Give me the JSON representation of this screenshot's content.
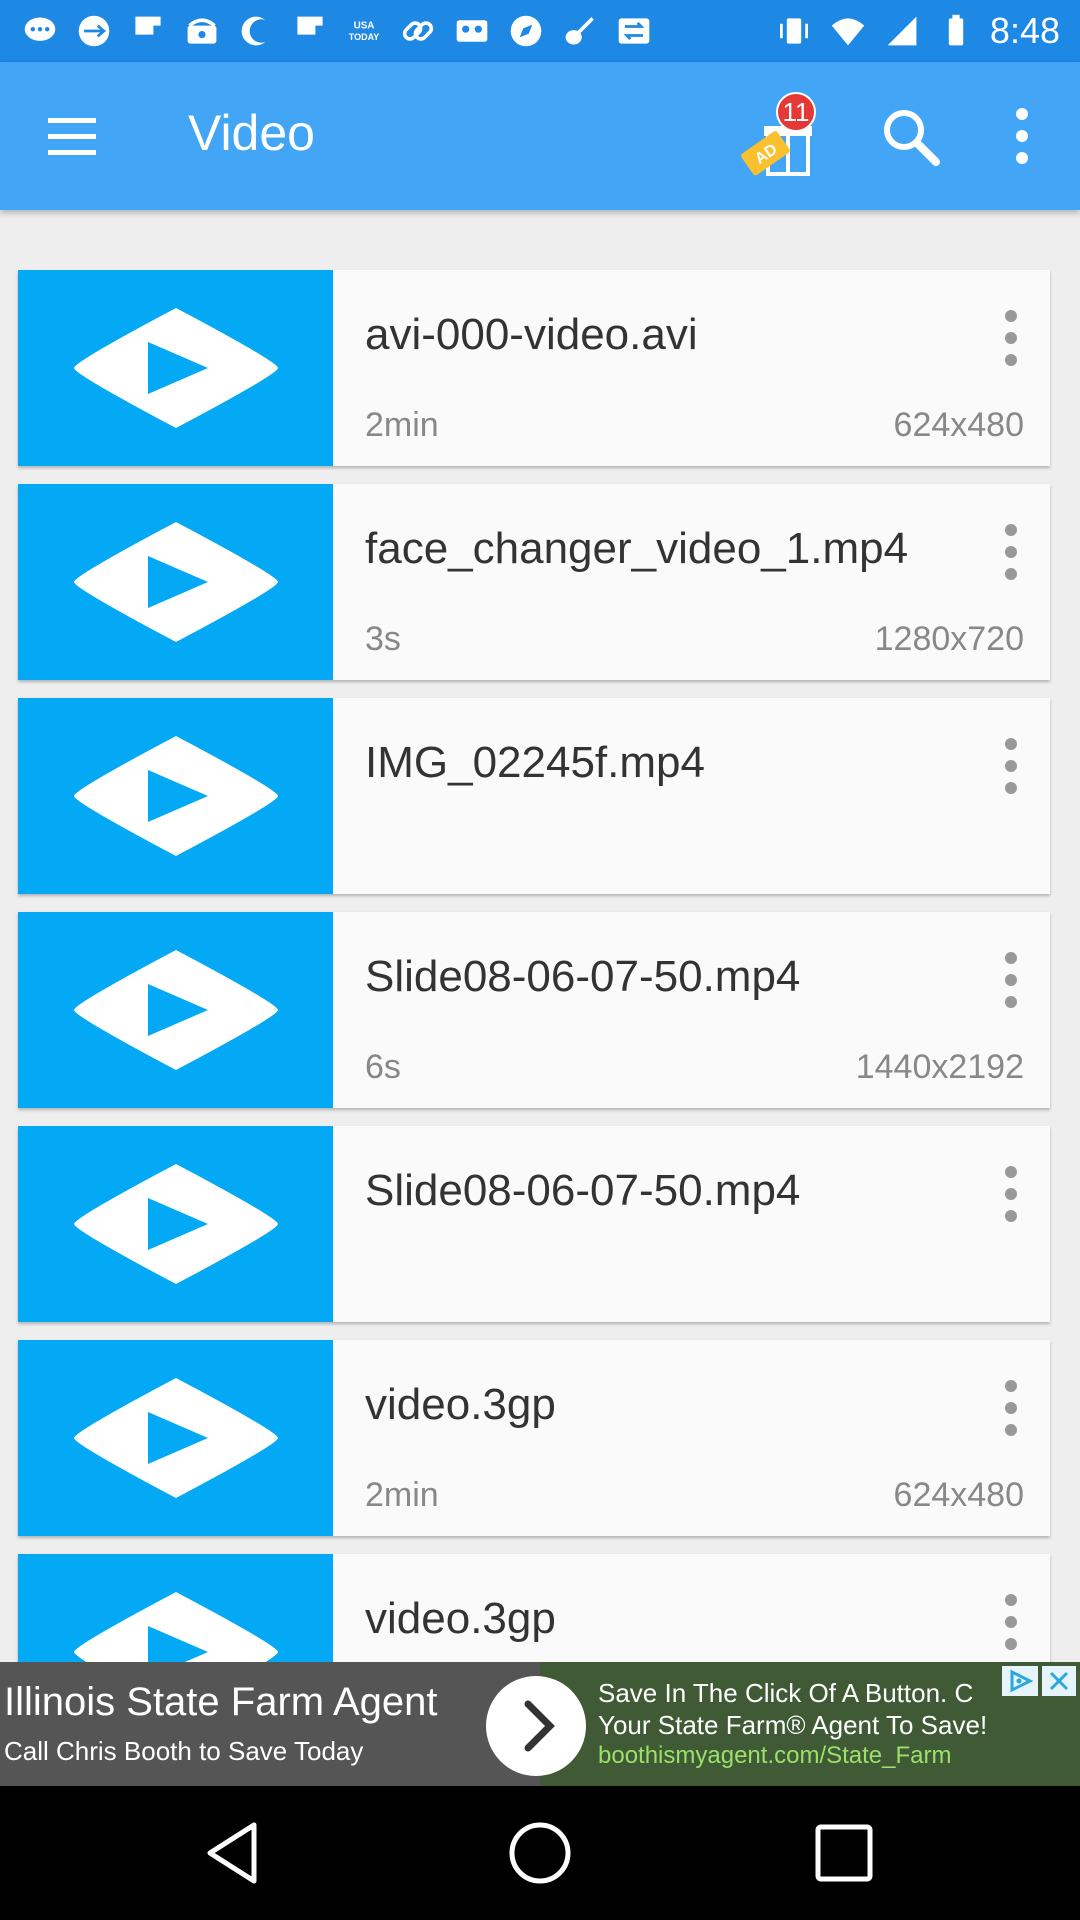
{
  "status_bar": {
    "time": "8:48",
    "icons": [
      "chat-bubble-icon",
      "usb-icon",
      "flipboard-icon",
      "phone-icon",
      "moon-icon",
      "flipboard-icon",
      "usa-today-icon",
      "link-icon",
      "cassette-icon",
      "compass-icon",
      "guitar-icon",
      "transfer-icon",
      "vibrate-icon",
      "wifi-icon",
      "signal-icon",
      "battery-icon"
    ],
    "usa_today": "USA TODAY"
  },
  "app_bar": {
    "title": "Video",
    "gift_badge": "11",
    "gift_tag": "AD"
  },
  "videos": [
    {
      "name": "avi-000-video.avi",
      "duration": "2min",
      "resolution": "624x480"
    },
    {
      "name": "face_changer_video_1.mp4",
      "duration": "3s",
      "resolution": "1280x720"
    },
    {
      "name": "IMG_02245f.mp4",
      "duration": "",
      "resolution": ""
    },
    {
      "name": "Slide08-06-07-50.mp4",
      "duration": "6s",
      "resolution": "1440x2192"
    },
    {
      "name": "Slide08-06-07-50.mp4",
      "duration": "",
      "resolution": ""
    },
    {
      "name": "video.3gp",
      "duration": "2min",
      "resolution": "624x480"
    },
    {
      "name": "video.3gp",
      "duration": "",
      "resolution": ""
    }
  ],
  "ad": {
    "headline": "Illinois State Farm Agent",
    "subline": "Call Chris Booth to Save Today",
    "text_line1": "Save In The Click Of A Button. C",
    "text_line2": "Your State Farm® Agent To Save!",
    "url": "boothismyagent.com/State_Farm"
  },
  "colors": {
    "status_bar": "#1E88E5",
    "app_bar": "#42A5F5",
    "thumbnail": "#03A9F4",
    "card": "#FAFAFA",
    "badge": "#E53935"
  }
}
